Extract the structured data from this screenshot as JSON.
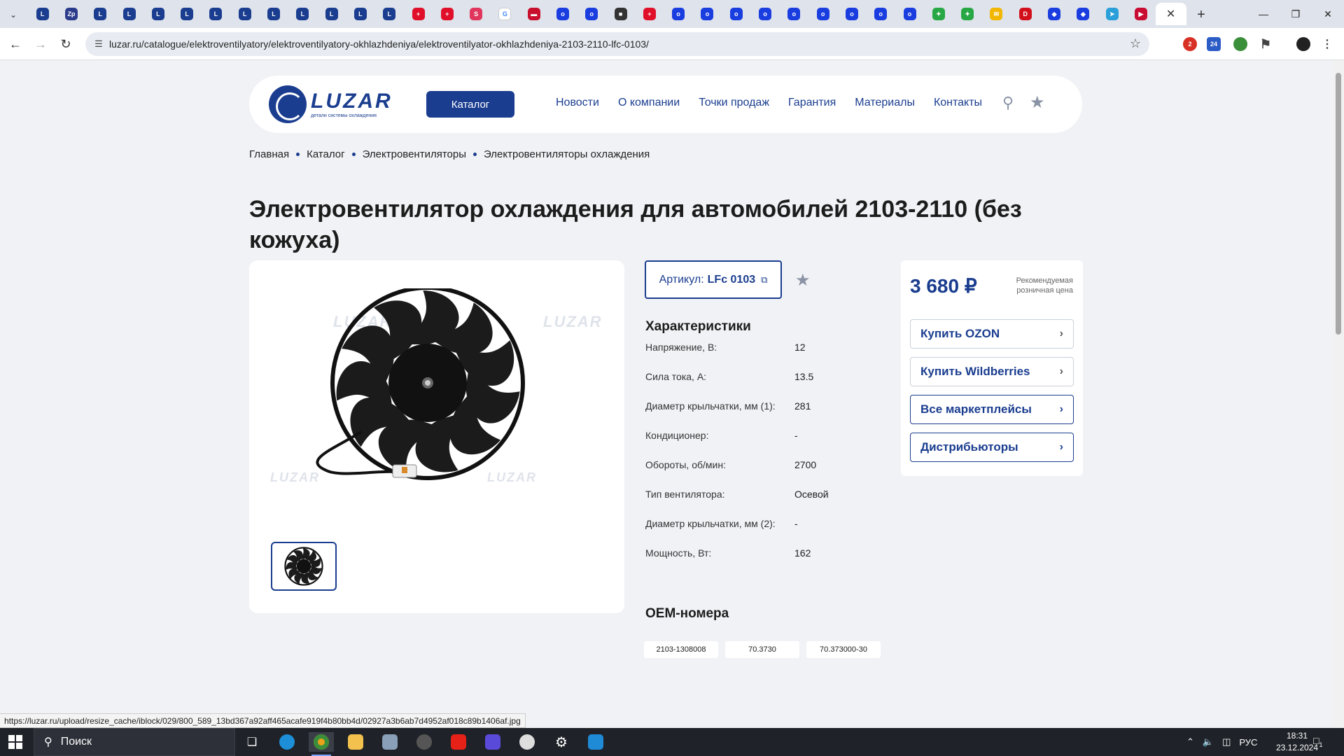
{
  "browser": {
    "tabs": [
      {
        "icon": "luzar-tab-icon",
        "color": "#1a3d8f",
        "glyph": "L"
      },
      {
        "icon": "zip-tab-icon",
        "color": "#2b3b8c",
        "glyph": "Zp"
      },
      {
        "icon": "luzar-tab-icon",
        "color": "#1a3d8f",
        "glyph": "L"
      },
      {
        "icon": "luzar-tab-icon",
        "color": "#1a3d8f",
        "glyph": "L"
      },
      {
        "icon": "luzar-tab-icon",
        "color": "#1a3d8f",
        "glyph": "L"
      },
      {
        "icon": "luzar-tab-icon",
        "color": "#1a3d8f",
        "glyph": "L"
      },
      {
        "icon": "luzar-tab-icon",
        "color": "#1a3d8f",
        "glyph": "L"
      },
      {
        "icon": "luzar-tab-icon",
        "color": "#1a3d8f",
        "glyph": "L"
      },
      {
        "icon": "luzar-tab-icon",
        "color": "#1a3d8f",
        "glyph": "L"
      },
      {
        "icon": "luzar-tab-icon",
        "color": "#1a3d8f",
        "glyph": "L"
      },
      {
        "icon": "luzar-tab-icon",
        "color": "#1a3d8f",
        "glyph": "L"
      },
      {
        "icon": "luzar-tab-icon",
        "color": "#1a3d8f",
        "glyph": "L"
      },
      {
        "icon": "luzar-tab-icon",
        "color": "#1a3d8f",
        "glyph": "L"
      },
      {
        "icon": "red-plus-tab-icon",
        "color": "#e0102a",
        "glyph": "+"
      },
      {
        "icon": "red-plus-tab-icon",
        "color": "#e0102a",
        "glyph": "+"
      },
      {
        "icon": "s-tab-icon",
        "color": "#e0365d",
        "glyph": "S"
      },
      {
        "icon": "google-tab-icon",
        "color": "#ffffff",
        "glyph": "G"
      },
      {
        "icon": "flag-tab-icon",
        "color": "#c8102e",
        "glyph": "▬"
      },
      {
        "icon": "ozon-tab-icon",
        "color": "#1a3de0",
        "glyph": "o"
      },
      {
        "icon": "ozon-tab-icon",
        "color": "#1a3de0",
        "glyph": "o"
      },
      {
        "icon": "dark-tab-icon",
        "color": "#333333",
        "glyph": "■"
      },
      {
        "icon": "red-plus-tab-icon",
        "color": "#e0102a",
        "glyph": "+"
      },
      {
        "icon": "ozon-tab-icon",
        "color": "#1a3de0",
        "glyph": "o"
      },
      {
        "icon": "ozon-tab-icon",
        "color": "#1a3de0",
        "glyph": "o"
      },
      {
        "icon": "ozon-tab-icon",
        "color": "#1a3de0",
        "glyph": "o"
      },
      {
        "icon": "ozon-tab-icon",
        "color": "#1a3de0",
        "glyph": "o"
      },
      {
        "icon": "ozon-tab-icon",
        "color": "#1a3de0",
        "glyph": "o"
      },
      {
        "icon": "ozon-tab-icon",
        "color": "#1a3de0",
        "glyph": "o"
      },
      {
        "icon": "ozon-tab-icon",
        "color": "#1a3de0",
        "glyph": "o"
      },
      {
        "icon": "ozon-tab-icon",
        "color": "#1a3de0",
        "glyph": "o"
      },
      {
        "icon": "ozon-tab-icon",
        "color": "#1a3de0",
        "glyph": "o"
      },
      {
        "icon": "colorful-tab-icon",
        "color": "#27a844",
        "glyph": "✦"
      },
      {
        "icon": "colorful-tab-icon",
        "color": "#27a844",
        "glyph": "✦"
      },
      {
        "icon": "mail-tab-icon",
        "color": "#f2b705",
        "glyph": "✉"
      },
      {
        "icon": "d-tab-icon",
        "color": "#d1101c",
        "glyph": "D"
      },
      {
        "icon": "shield-tab-icon",
        "color": "#1a3de0",
        "glyph": "◆"
      },
      {
        "icon": "shield-tab-icon",
        "color": "#1a3de0",
        "glyph": "◆"
      },
      {
        "icon": "telegram-tab-icon",
        "color": "#2a9fd9",
        "glyph": "➤"
      },
      {
        "icon": "play-tab-icon",
        "color": "#c80c32",
        "glyph": "▶"
      }
    ],
    "active_tab_close": "✕",
    "new_tab": "+",
    "url": "luzar.ru/catalogue/elektroventilyatory/elektroventilyatory-okhlazhdeniya/elektroventilyator-okhlazhdeniya-2103-2110-lfc-0103/",
    "extension_badge_count": "2",
    "extension_badge_24": "24",
    "status_url": "https://luzar.ru/upload/resize_cache/iblock/029/800_589_13bd367a92aff465acafe919f4b80bb4d/02927a3b6ab7d4952af018c89b1406af.jpg"
  },
  "header": {
    "logo_word": "LUZAR",
    "logo_sub": "детали системы охлаждения",
    "catalog_button": "Каталог",
    "nav": [
      "Новости",
      "О компании",
      "Точки продаж",
      "Гарантия",
      "Материалы",
      "Контакты"
    ]
  },
  "breadcrumb": [
    "Главная",
    "Каталог",
    "Электровентиляторы",
    "Электровентиляторы охлаждения"
  ],
  "product": {
    "title": "Электровентилятор охлаждения для автомобилей 2103-2110 (без кожуха)",
    "watermark": "LUZAR",
    "sku_label": "Артикул:",
    "sku_value": "LFc 0103",
    "specs_title": "Характеристики",
    "specs": [
      {
        "k": "Напряжение, В:",
        "v": "12"
      },
      {
        "k": "Сила тока, А:",
        "v": "13.5"
      },
      {
        "k": "Диаметр крыльчатки, мм (1):",
        "v": "281"
      },
      {
        "k": "Кондиционер:",
        "v": "-"
      },
      {
        "k": "Обороты, об/мин:",
        "v": "2700"
      },
      {
        "k": "Тип вентилятора:",
        "v": "Осевой"
      },
      {
        "k": "Диаметр крыльчатки, мм (2):",
        "v": "-"
      },
      {
        "k": "Мощность, Вт:",
        "v": "162"
      }
    ],
    "oem_title": "ОЕМ-номера",
    "oem": [
      "2103-1308008",
      "70.3730",
      "70.373000-30"
    ]
  },
  "price_panel": {
    "price": "3 680 ₽",
    "price_note_1": "Рекомендуемая",
    "price_note_2": "розничная цена",
    "buttons": [
      "Купить OZON",
      "Купить Wildberries",
      "Все маркетплейсы",
      "Дистрибьюторы"
    ]
  },
  "taskbar": {
    "search_label": "Поиск",
    "lang": "РУС",
    "time": "18:31",
    "date": "23.12.2024",
    "notifications": "1"
  },
  "colors": {
    "brand": "#1a3d8f",
    "page_bg": "#f1f2f6"
  }
}
